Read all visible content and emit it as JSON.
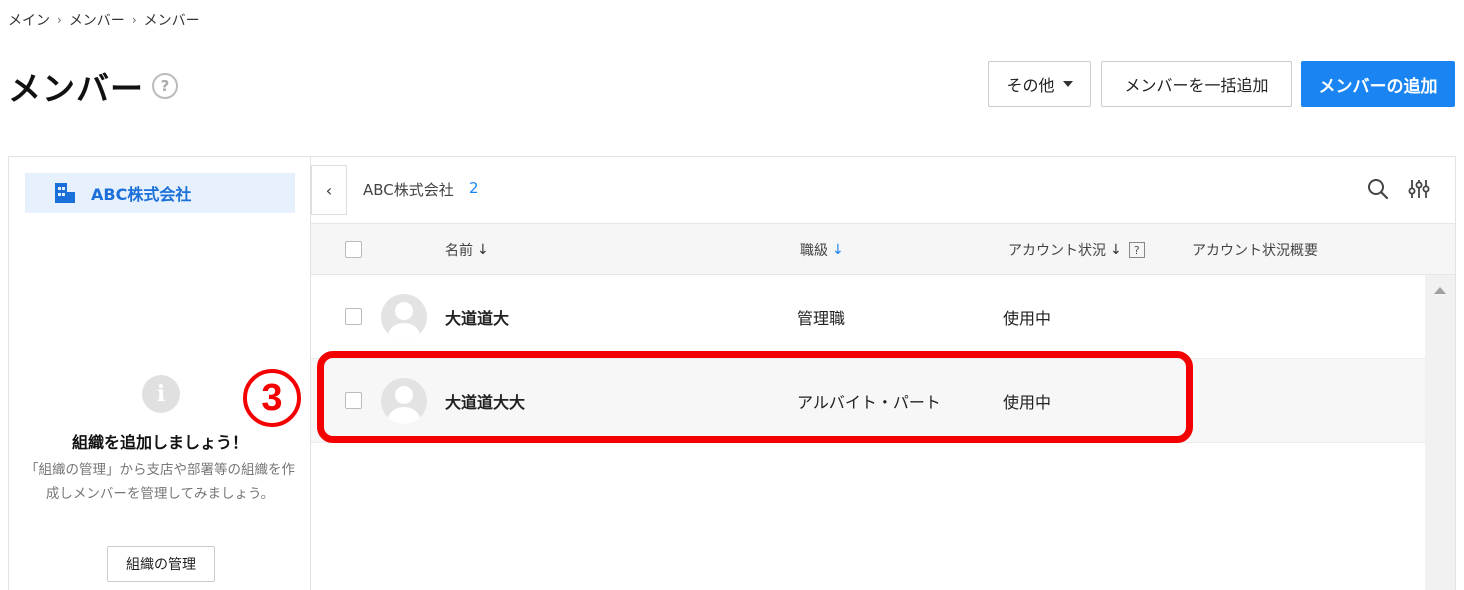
{
  "breadcrumb": [
    "メイン",
    "メンバー",
    "メンバー"
  ],
  "breadcrumb_separator": "›",
  "page": {
    "title": "メンバー",
    "help_glyph": "?"
  },
  "toolbar": {
    "other_label": "その他",
    "bulk_add_label": "メンバーを一括追加",
    "add_member_label": "メンバーの追加",
    "accent_color": "#1a85f2"
  },
  "sidebar": {
    "org_name": "ABC株式会社",
    "empty_icon_glyph": "i",
    "empty_title": "組織を追加しましょう！",
    "empty_description": "「組織の管理」から支店や部署等の組織を作成しメンバーを管理してみましょう。",
    "manage_button": "組織の管理"
  },
  "main": {
    "collapse_glyph": "‹",
    "org_name": "ABC株式会社",
    "member_count": "2",
    "icons": [
      "search-icon",
      "filter-settings-icon"
    ]
  },
  "table": {
    "headers": {
      "name": "名前",
      "rank": "職級",
      "account_status": "アカウント状況",
      "account_summary": "アカウント状況概要",
      "sort_glyph": "↓",
      "help_glyph": "?"
    },
    "rows": [
      {
        "name": "大道道大",
        "rank": "管理職",
        "status": "使用中",
        "summary": ""
      },
      {
        "name": "大道道大大",
        "rank": "アルバイト・パート",
        "status": "使用中",
        "summary": ""
      }
    ]
  },
  "annotation": {
    "step_label": "3",
    "color": "#f50000"
  }
}
